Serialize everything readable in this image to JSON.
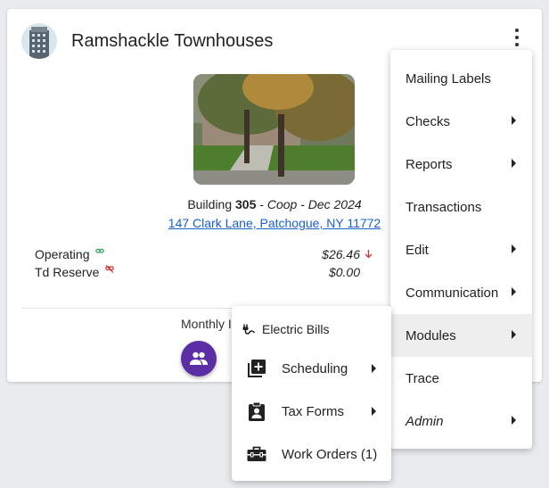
{
  "card": {
    "title": "Ramshackle Townhouses",
    "building_prefix": "Building ",
    "building_number": "305",
    "building_sep": " - ",
    "building_type": "Coop - Dec 2024",
    "address": "147 Clark Lane, Patchogue, NY 11772",
    "accounts": [
      {
        "name": "Operating",
        "amount": "$26.46",
        "icon": "link-icon"
      },
      {
        "name": "Td Reserve",
        "amount": "$0.00",
        "icon": "link-off-icon"
      }
    ],
    "monthly_label": "Monthly I"
  },
  "main_menu": {
    "items": [
      {
        "label": "Mailing Labels"
      },
      {
        "label": "Checks"
      },
      {
        "label": "Reports"
      },
      {
        "label": "Transactions"
      },
      {
        "label": "Edit"
      },
      {
        "label": "Communication"
      },
      {
        "label": "Modules"
      },
      {
        "label": "Trace"
      },
      {
        "label": "Admin"
      }
    ]
  },
  "sub_menu": {
    "items": [
      {
        "label": "Electric Bills"
      },
      {
        "label": "Scheduling"
      },
      {
        "label": "Tax Forms"
      },
      {
        "label": "Work Orders (1)"
      }
    ]
  },
  "colors": {
    "accent": "#5b2ea6",
    "link": "#1a5fd0",
    "up_link": "#2e9e5b",
    "down": "#d0312d"
  }
}
